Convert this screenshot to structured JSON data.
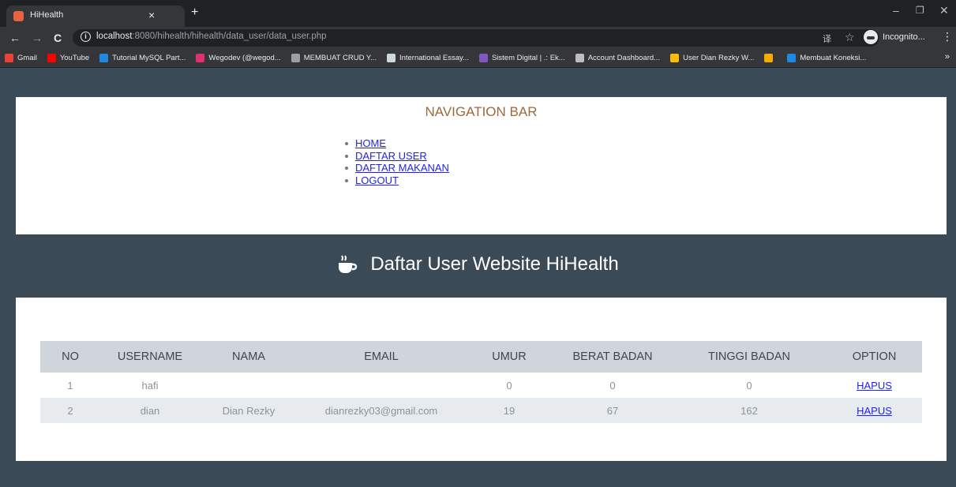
{
  "browser": {
    "tab_title": "HiHealth",
    "tab_close": "×",
    "new_tab": "+",
    "window_controls": {
      "minimize": "–",
      "restore": "❐",
      "close": "✕"
    },
    "nav": {
      "back": "←",
      "forward": "→",
      "reload": "C"
    },
    "url_host": "localhost",
    "url_path": ":8080/hihealth/hihealth/data_user/data_user.php",
    "star": "☆",
    "translate": "译",
    "incognito_label": "Incognito...",
    "menu": "⋮",
    "bookmarks": [
      {
        "label": "Gmail",
        "color": "#ea4335"
      },
      {
        "label": "YouTube",
        "color": "#ff0000"
      },
      {
        "label": "Tutorial MySQL Part...",
        "color": "#1e88e5"
      },
      {
        "label": "Wegodev (@wegod...",
        "color": "#e1306c"
      },
      {
        "label": "MEMBUAT CRUD Y...",
        "color": "#9aa0a6"
      },
      {
        "label": "International Essay...",
        "color": "#cfd8dc"
      },
      {
        "label": "Sistem Digital | .: Ek...",
        "color": "#7e57c2"
      },
      {
        "label": "Account Dashboard...",
        "color": "#bdbdbd"
      },
      {
        "label": "User Dian Rezky W...",
        "color": "#fbbc04"
      },
      {
        "label": "",
        "color": "#f9ab00"
      },
      {
        "label": "Membuat Koneksi...",
        "color": "#1e88e5"
      }
    ],
    "bookmarks_more": "»"
  },
  "nav": {
    "title": "NAVIGATION BAR",
    "links": [
      "HOME",
      "DAFTAR USER",
      "DAFTAR MAKANAN",
      "LOGOUT"
    ]
  },
  "hero": {
    "title": "Daftar User Website HiHealth",
    "icon": "coffee-cup-icon"
  },
  "table": {
    "headers": [
      "NO",
      "USERNAME",
      "NAMA",
      "EMAIL",
      "UMUR",
      "BERAT BADAN",
      "TINGGI BADAN",
      "OPTION"
    ],
    "rows": [
      [
        "1",
        "hafi",
        "",
        "",
        "0",
        "0",
        "0",
        "HAPUS"
      ],
      [
        "2",
        "dian",
        "Dian Rezky",
        "dianrezky03@gmail.com",
        "19",
        "67",
        "162",
        "HAPUS"
      ]
    ]
  },
  "colors": {
    "page_bg": "#3b4a57",
    "nav_title": "#9b6a3a",
    "link": "#2323e6",
    "table_header_bg": "#cfd5da",
    "row_alt_bg": "#e8ebed"
  }
}
